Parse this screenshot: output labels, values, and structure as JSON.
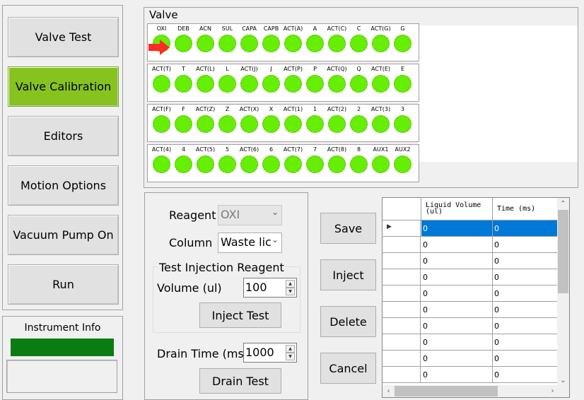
{
  "nav": {
    "buttons": [
      {
        "label": "Valve Test",
        "active": false
      },
      {
        "label": "Valve Calibration",
        "active": true
      },
      {
        "label": "Editors",
        "active": false
      },
      {
        "label": "Motion Options",
        "active": false
      },
      {
        "label": "Vacuum Pump On",
        "active": false
      },
      {
        "label": "Run",
        "active": false
      }
    ],
    "active_color": "#86c31f"
  },
  "instrument_info": {
    "title": "Instrument Info",
    "status_color": "#0a7d12"
  },
  "valve": {
    "title": "Valve",
    "circle_color": "#66ee05",
    "pointer_color": "#ff2a2a",
    "pointer_icon": "red-arrow-right",
    "rows": [
      [
        "OXI",
        "DEB",
        "ACN",
        "SUL",
        "CAPA",
        "CAPB",
        "ACT(A)",
        "A",
        "ACT(C)",
        "C",
        "ACT(G)",
        "G"
      ],
      [
        "ACT(T)",
        "T",
        "ACT(L)",
        "L",
        "ACT(J)",
        "J",
        "ACT(P)",
        "P",
        "ACT(Q)",
        "Q",
        "ACT(E)",
        "E"
      ],
      [
        "ACT(F)",
        "F",
        "ACT(Z)",
        "Z",
        "ACT(X)",
        "X",
        "ACT(1)",
        "1",
        "ACT(2)",
        "2",
        "ACT(3)",
        "3"
      ],
      [
        "ACT(4)",
        "4",
        "ACT(5)",
        "5",
        "ACT(6)",
        "6",
        "ACT(7)",
        "7",
        "ACT(8)",
        "8",
        "AUX1",
        "AUX2"
      ]
    ]
  },
  "reagent_panel": {
    "reagent_label": "Reagent",
    "reagent_value": "OXI",
    "column_label": "Column",
    "column_value": "Waste lic",
    "test_group_title": "Test Injection Reagent",
    "volume_label": "Volume (ul)",
    "volume_value": "100",
    "inject_test_label": "Inject Test",
    "drain_time_label": "Drain Time (ms)",
    "drain_time_value": "1000",
    "drain_test_label": "Drain Test"
  },
  "actions": {
    "save": "Save",
    "inject": "Inject",
    "delete": "Delete",
    "cancel": "Cancel"
  },
  "grid": {
    "columns": [
      "Liquid Volume\n(ul)",
      "Time (ms)"
    ],
    "rows": [
      [
        "0",
        "0"
      ],
      [
        "0",
        "0"
      ],
      [
        "0",
        "0"
      ],
      [
        "0",
        "0"
      ],
      [
        "0",
        "0"
      ],
      [
        "0",
        "0"
      ],
      [
        "0",
        "0"
      ],
      [
        "0",
        "0"
      ],
      [
        "0",
        "0"
      ],
      [
        "0",
        "0"
      ]
    ],
    "selected_row": 0,
    "selected_color": "#0078d7"
  }
}
